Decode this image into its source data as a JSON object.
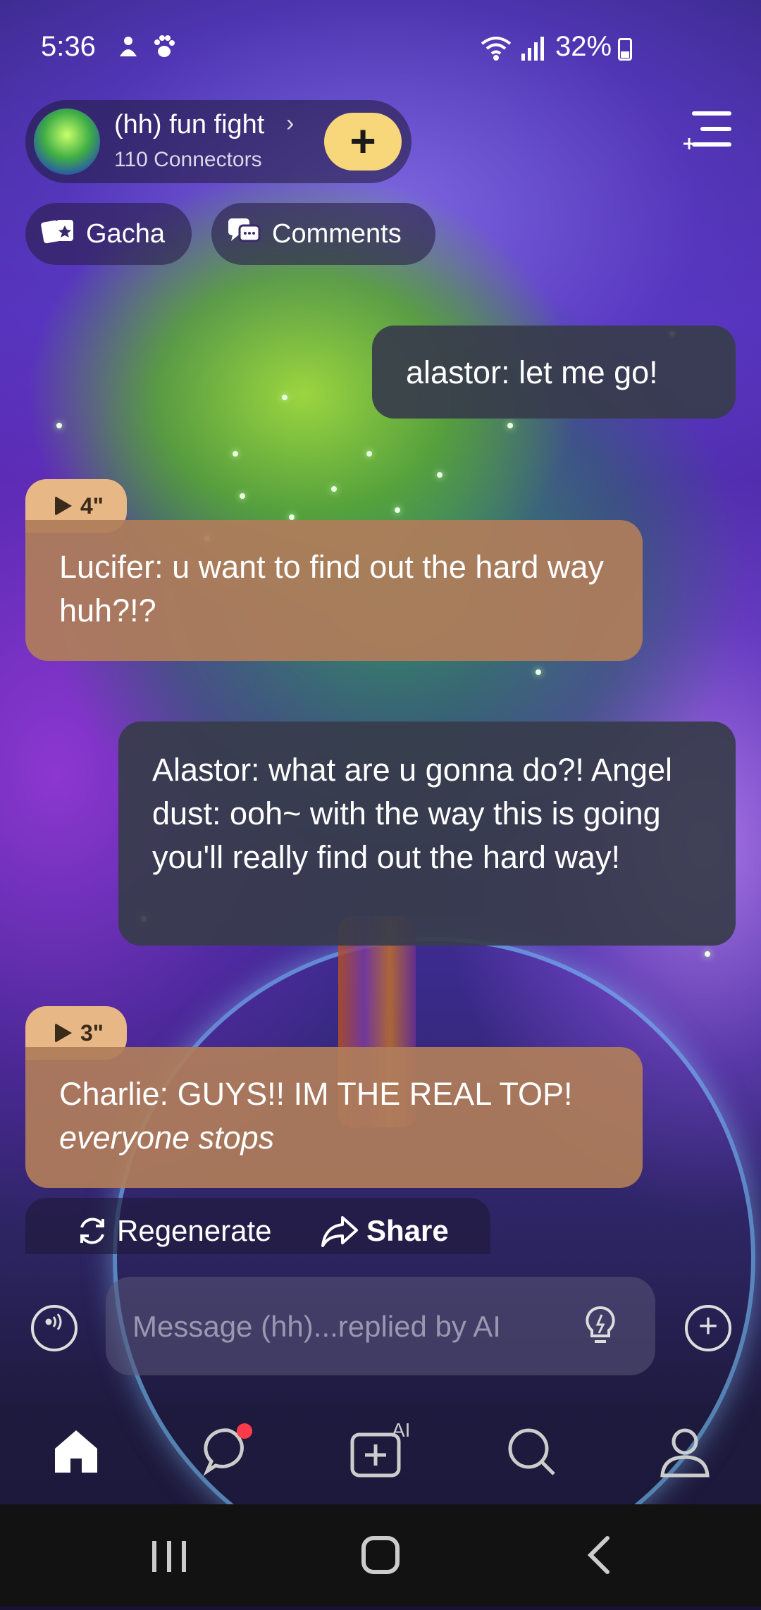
{
  "status_bar": {
    "time": "5:36",
    "battery": "32%"
  },
  "chat_header": {
    "title": "(hh) fun fight",
    "chevron": "›",
    "subtitle": "110 Connectors",
    "join_label": "+"
  },
  "pills": {
    "gacha": "Gacha",
    "comments": "Comments"
  },
  "messages": [
    {
      "text": "alastor: let me go!",
      "style": "dark"
    },
    {
      "text": "Lucifer: u want to find out the hard way huh?!?",
      "style": "brown",
      "duration": "4\""
    },
    {
      "text": "Alastor: what are u gonna do?! Angel dust: ooh~ with the way this is going you'll really find out the hard way!",
      "style": "dark"
    },
    {
      "text_plain": "Charlie: GUYS!! IM THE REAL TOP! ",
      "text_italic": "everyone stops",
      "style": "brown",
      "duration": "3\""
    }
  ],
  "actions": {
    "regenerate": "Regenerate",
    "share": "Share"
  },
  "input": {
    "placeholder": "Message (hh)...replied by AI",
    "value": ""
  },
  "bottom_nav": {
    "items": [
      "home-icon",
      "chat-icon",
      "create-ai-icon",
      "search-icon",
      "profile-icon"
    ],
    "ai_badge": "AI"
  },
  "colors": {
    "accent_yellow": "#f7d77a",
    "bubble_dark": "#373c4b",
    "bubble_brown": "#af7d5a",
    "notification": "#ff3b4a"
  }
}
